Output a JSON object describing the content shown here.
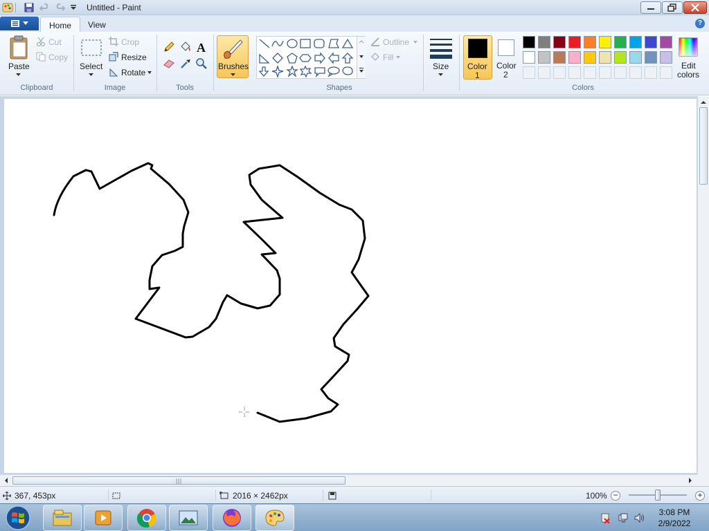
{
  "window": {
    "title": "Untitled - Paint"
  },
  "tabs": {
    "home": "Home",
    "view": "View"
  },
  "clipboard": {
    "label": "Clipboard",
    "paste": "Paste",
    "cut": "Cut",
    "copy": "Copy"
  },
  "image": {
    "label": "Image",
    "select": "Select",
    "crop": "Crop",
    "resize": "Resize",
    "rotate": "Rotate"
  },
  "tools": {
    "label": "Tools",
    "items": [
      "pencil-icon",
      "fill-icon",
      "text-icon",
      "eraser-icon",
      "color-picker-icon",
      "magnifier-icon"
    ]
  },
  "brushes": {
    "label": "Brushes"
  },
  "shapes": {
    "label": "Shapes",
    "outline": "Outline",
    "fill": "Fill"
  },
  "size": {
    "label": "Size"
  },
  "colors": {
    "label": "Colors",
    "color1_label": "Color",
    "color1_num": "1",
    "color2_label": "Color",
    "color2_num": "2",
    "edit_label": "Edit",
    "edit_label2": "colors",
    "color1": "#000000",
    "color2": "#ffffff",
    "row1": [
      "#000000",
      "#7f7f7f",
      "#880015",
      "#ed1c24",
      "#ff7f27",
      "#fff200",
      "#22b14c",
      "#00a2e8",
      "#3f48cc",
      "#a349a4"
    ],
    "row2": [
      "#ffffff",
      "#c3c3c3",
      "#b97a57",
      "#ffaec9",
      "#ffc90e",
      "#efe4b0",
      "#b5e61d",
      "#99d9ea",
      "#7092be",
      "#c8bfe7"
    ]
  },
  "status": {
    "cursor_pos": "367, 453px",
    "canvas_size": "2016 × 2462px",
    "zoom": "100%"
  },
  "taskbar": {
    "time": "3:08 PM",
    "date": "2/9/2022"
  }
}
